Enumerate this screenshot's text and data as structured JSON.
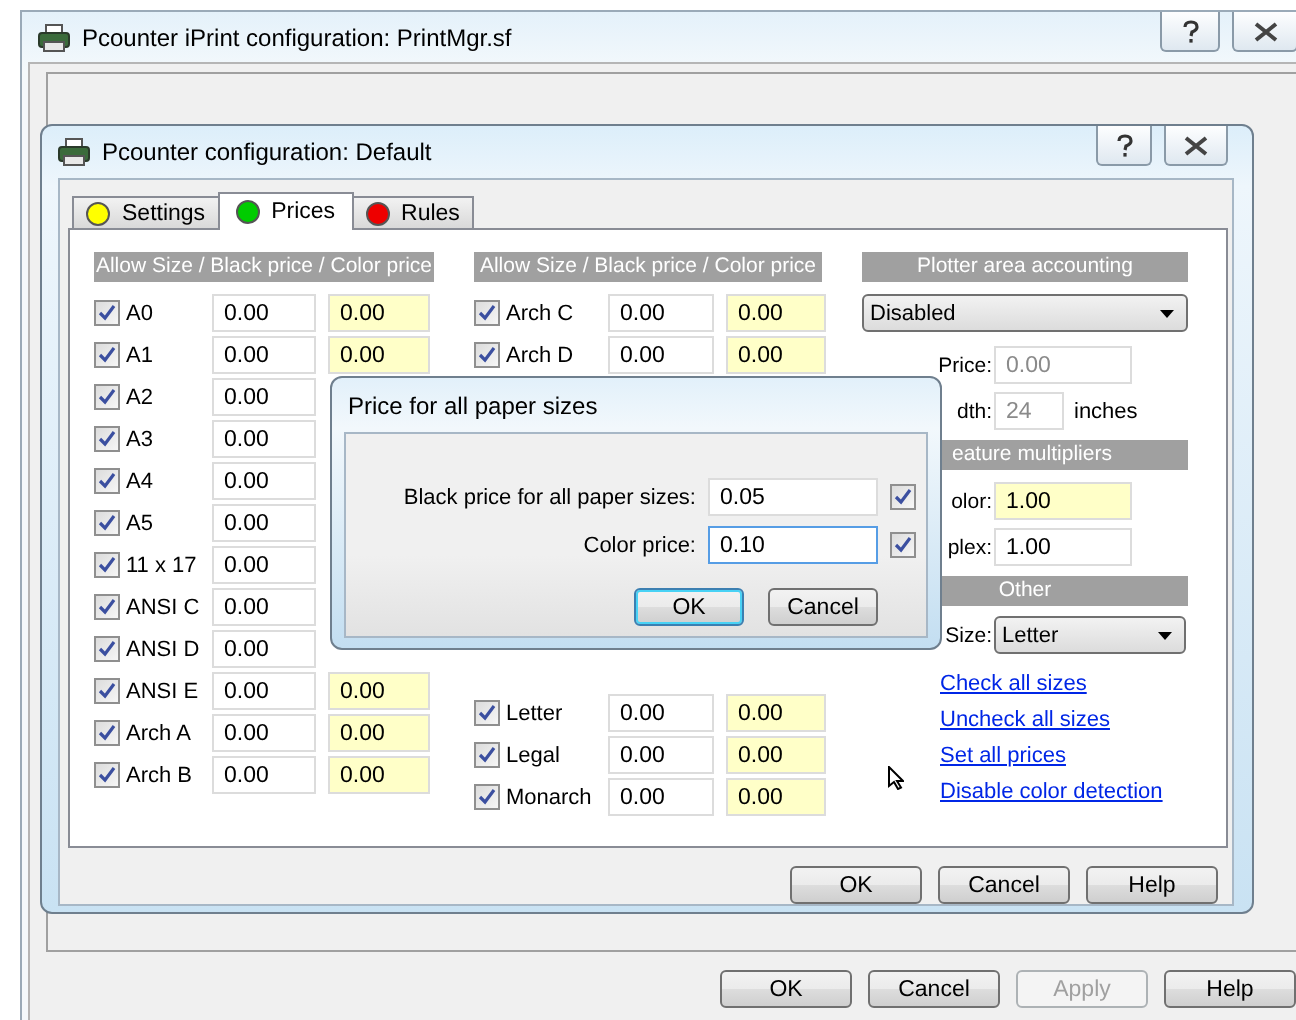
{
  "outer_window": {
    "title": "Pcounter iPrint configuration: PrintMgr.sf",
    "buttons": [
      {
        "label": "OK",
        "disabled": false
      },
      {
        "label": "Cancel",
        "disabled": false
      },
      {
        "label": "Apply",
        "disabled": true
      },
      {
        "label": "Help",
        "disabled": false
      }
    ]
  },
  "dialog": {
    "title": "Pcounter configuration: Default",
    "tabs": [
      {
        "label": "Settings",
        "color": "#ffff00",
        "selected": false
      },
      {
        "label": "Prices",
        "color": "#00cc00",
        "selected": true
      },
      {
        "label": "Rules",
        "color": "#ee0000",
        "selected": false
      }
    ],
    "size_columns": [
      {
        "header": "Allow Size / Black price / Color price",
        "rows_top": [
          {
            "label": "A0",
            "checked": true,
            "black_price": "0.00",
            "color_price": "0.00"
          },
          {
            "label": "A1",
            "checked": true,
            "black_price": "0.00",
            "color_price": "0.00"
          },
          {
            "label": "A2",
            "checked": true,
            "black_price": "0.00"
          },
          {
            "label": "A3",
            "checked": true,
            "black_price": "0.00"
          },
          {
            "label": "A4",
            "checked": true,
            "black_price": "0.00"
          },
          {
            "label": "A5",
            "checked": true,
            "black_price": "0.00"
          },
          {
            "label": "11 x 17",
            "checked": true,
            "black_price": "0.00"
          },
          {
            "label": "ANSI C",
            "checked": true,
            "black_price": "0.00"
          },
          {
            "label": "ANSI D",
            "checked": true,
            "black_price": "0.00"
          },
          {
            "label": "ANSI E",
            "checked": true,
            "black_price": "0.00",
            "color_price": "0.00"
          },
          {
            "label": "Arch A",
            "checked": true,
            "black_price": "0.00",
            "color_price": "0.00"
          },
          {
            "label": "Arch B",
            "checked": true,
            "black_price": "0.00",
            "color_price": "0.00"
          }
        ]
      },
      {
        "header": "Allow Size / Black price / Color price",
        "rows_top": [
          {
            "label": "Arch C",
            "checked": true,
            "black_price": "0.00",
            "color_price": "0.00"
          },
          {
            "label": "Arch D",
            "checked": true,
            "black_price": "0.00",
            "color_price": "0.00"
          }
        ],
        "rows_bottom": [
          {
            "label": "Letter",
            "checked": true,
            "black_price": "0.00",
            "color_price": "0.00"
          },
          {
            "label": "Legal",
            "checked": true,
            "black_price": "0.00",
            "color_price": "0.00"
          },
          {
            "label": "Monarch",
            "checked": true,
            "black_price": "0.00",
            "color_price": "0.00"
          }
        ]
      }
    ],
    "plotter": {
      "header": "Plotter area accounting",
      "mode": "Disabled",
      "fields": [
        {
          "label": "Price:",
          "value": "0.00",
          "disabled": true
        },
        {
          "label": "dth:",
          "value": "24",
          "unit": "inches",
          "disabled": true
        }
      ]
    },
    "multipliers": {
      "header": "eature multipliers",
      "fields": [
        {
          "label": "olor:",
          "value": "1.00",
          "kind": "color"
        },
        {
          "label": "plex:",
          "value": "1.00",
          "kind": "black"
        }
      ]
    },
    "other": {
      "header": "Other",
      "size_label": "Size:",
      "size": "Letter"
    },
    "links": [
      "Check all sizes",
      "Uncheck all sizes",
      "Set all prices",
      "Disable color detection"
    ],
    "buttons": [
      "OK",
      "Cancel",
      "Help"
    ]
  },
  "price_dialog": {
    "title": "Price for all paper sizes",
    "fields": [
      {
        "label": "Black price for all paper sizes:",
        "value": "0.05",
        "checked": true,
        "focused": false
      },
      {
        "label": "Color price:",
        "value": "0.10",
        "checked": true,
        "focused": true
      }
    ],
    "buttons": [
      {
        "label": "OK",
        "default": true
      },
      {
        "label": "Cancel",
        "default": false
      }
    ]
  }
}
